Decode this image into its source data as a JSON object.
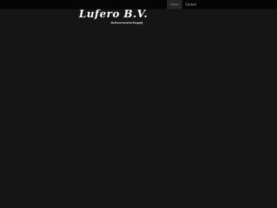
{
  "header": {
    "logo_title": "Lufero B.V.",
    "logo_subtitle": "Beheermaatschappij"
  },
  "nav": {
    "items": [
      {
        "label": "Home",
        "active": true
      },
      {
        "label": "Contact",
        "active": false
      }
    ]
  },
  "colors": {
    "background": "#151515",
    "topbar": "#050505",
    "active_tab": "#262626",
    "logo_text": "#ffffff"
  }
}
